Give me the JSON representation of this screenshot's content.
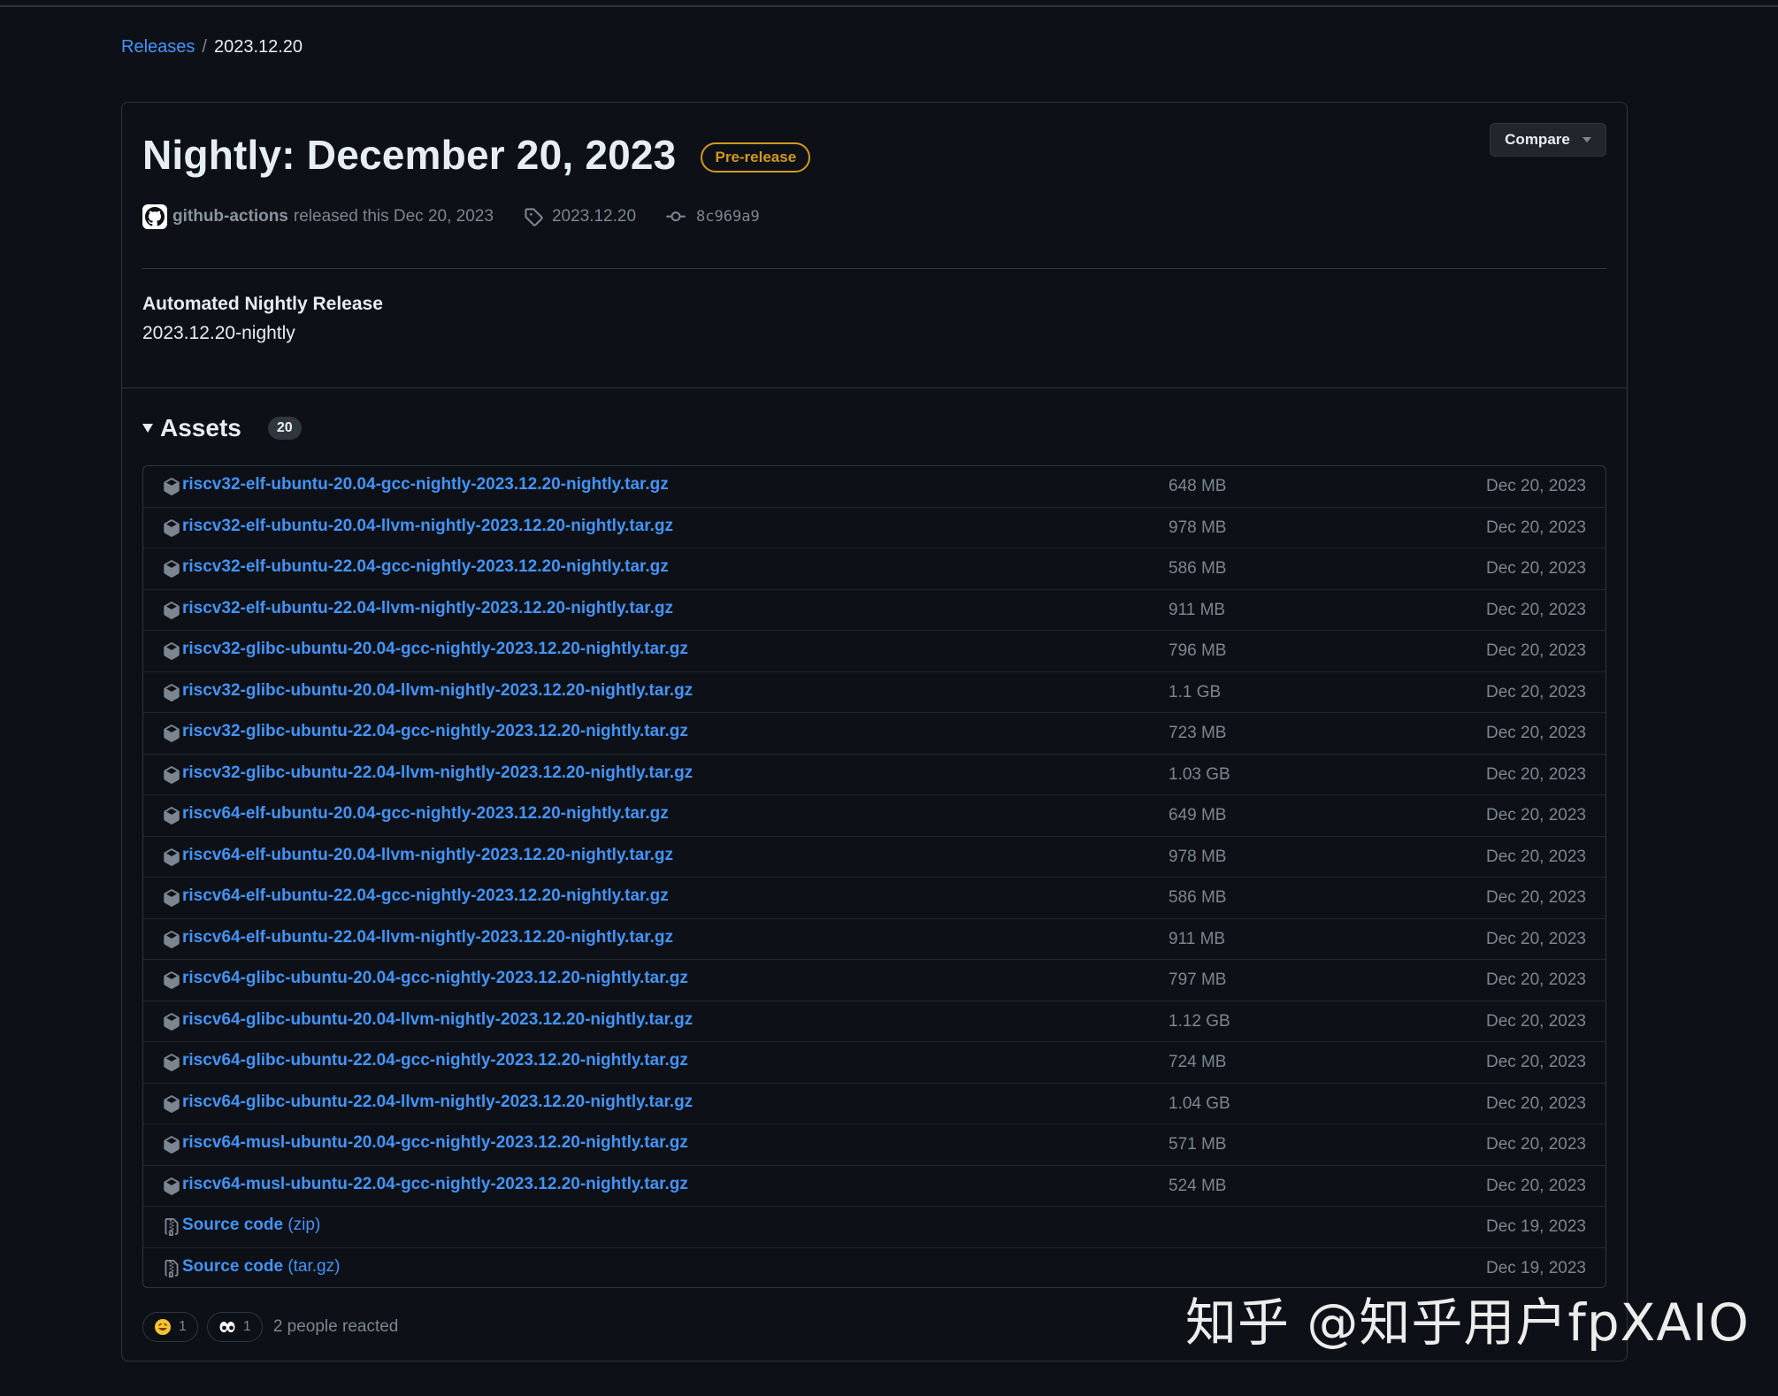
{
  "breadcrumb": {
    "releases": "Releases",
    "separator": "/",
    "current": "2023.12.20"
  },
  "release": {
    "title": "Nightly: December 20, 2023",
    "badge": "Pre-release",
    "compare_label": "Compare",
    "author": "github-actions",
    "released_text": "released this Dec 20, 2023",
    "tag": "2023.12.20",
    "commit": "8c969a9",
    "notes_title": "Automated Nightly Release",
    "notes_body": "2023.12.20-nightly"
  },
  "assets": {
    "label": "Assets",
    "count": "20",
    "items": [
      {
        "name": "riscv32-elf-ubuntu-20.04-gcc-nightly-2023.12.20-nightly.tar.gz",
        "size": "648 MB",
        "date": "Dec 20, 2023"
      },
      {
        "name": "riscv32-elf-ubuntu-20.04-llvm-nightly-2023.12.20-nightly.tar.gz",
        "size": "978 MB",
        "date": "Dec 20, 2023"
      },
      {
        "name": "riscv32-elf-ubuntu-22.04-gcc-nightly-2023.12.20-nightly.tar.gz",
        "size": "586 MB",
        "date": "Dec 20, 2023"
      },
      {
        "name": "riscv32-elf-ubuntu-22.04-llvm-nightly-2023.12.20-nightly.tar.gz",
        "size": "911 MB",
        "date": "Dec 20, 2023"
      },
      {
        "name": "riscv32-glibc-ubuntu-20.04-gcc-nightly-2023.12.20-nightly.tar.gz",
        "size": "796 MB",
        "date": "Dec 20, 2023"
      },
      {
        "name": "riscv32-glibc-ubuntu-20.04-llvm-nightly-2023.12.20-nightly.tar.gz",
        "size": "1.1 GB",
        "date": "Dec 20, 2023"
      },
      {
        "name": "riscv32-glibc-ubuntu-22.04-gcc-nightly-2023.12.20-nightly.tar.gz",
        "size": "723 MB",
        "date": "Dec 20, 2023"
      },
      {
        "name": "riscv32-glibc-ubuntu-22.04-llvm-nightly-2023.12.20-nightly.tar.gz",
        "size": "1.03 GB",
        "date": "Dec 20, 2023"
      },
      {
        "name": "riscv64-elf-ubuntu-20.04-gcc-nightly-2023.12.20-nightly.tar.gz",
        "size": "649 MB",
        "date": "Dec 20, 2023"
      },
      {
        "name": "riscv64-elf-ubuntu-20.04-llvm-nightly-2023.12.20-nightly.tar.gz",
        "size": "978 MB",
        "date": "Dec 20, 2023"
      },
      {
        "name": "riscv64-elf-ubuntu-22.04-gcc-nightly-2023.12.20-nightly.tar.gz",
        "size": "586 MB",
        "date": "Dec 20, 2023"
      },
      {
        "name": "riscv64-elf-ubuntu-22.04-llvm-nightly-2023.12.20-nightly.tar.gz",
        "size": "911 MB",
        "date": "Dec 20, 2023"
      },
      {
        "name": "riscv64-glibc-ubuntu-20.04-gcc-nightly-2023.12.20-nightly.tar.gz",
        "size": "797 MB",
        "date": "Dec 20, 2023"
      },
      {
        "name": "riscv64-glibc-ubuntu-20.04-llvm-nightly-2023.12.20-nightly.tar.gz",
        "size": "1.12 GB",
        "date": "Dec 20, 2023"
      },
      {
        "name": "riscv64-glibc-ubuntu-22.04-gcc-nightly-2023.12.20-nightly.tar.gz",
        "size": "724 MB",
        "date": "Dec 20, 2023"
      },
      {
        "name": "riscv64-glibc-ubuntu-22.04-llvm-nightly-2023.12.20-nightly.tar.gz",
        "size": "1.04 GB",
        "date": "Dec 20, 2023"
      },
      {
        "name": "riscv64-musl-ubuntu-20.04-gcc-nightly-2023.12.20-nightly.tar.gz",
        "size": "571 MB",
        "date": "Dec 20, 2023"
      },
      {
        "name": "riscv64-musl-ubuntu-22.04-gcc-nightly-2023.12.20-nightly.tar.gz",
        "size": "524 MB",
        "date": "Dec 20, 2023"
      }
    ],
    "source": [
      {
        "label": "Source code",
        "suffix": "(zip)",
        "date": "Dec 19, 2023"
      },
      {
        "label": "Source code",
        "suffix": "(tar.gz)",
        "date": "Dec 19, 2023"
      }
    ]
  },
  "reactions": {
    "items": [
      {
        "icon": "laugh-emoji-icon",
        "count": "1"
      },
      {
        "icon": "eyes-emoji-icon",
        "count": "1"
      }
    ],
    "summary": "2 people reacted"
  },
  "watermark": "知乎 @知乎用户fpXAIO",
  "colors": {
    "background": "#0d1117",
    "link": "#4493f8",
    "muted": "#7d8590",
    "border": "#30363d",
    "prerelease": "#d29922"
  }
}
